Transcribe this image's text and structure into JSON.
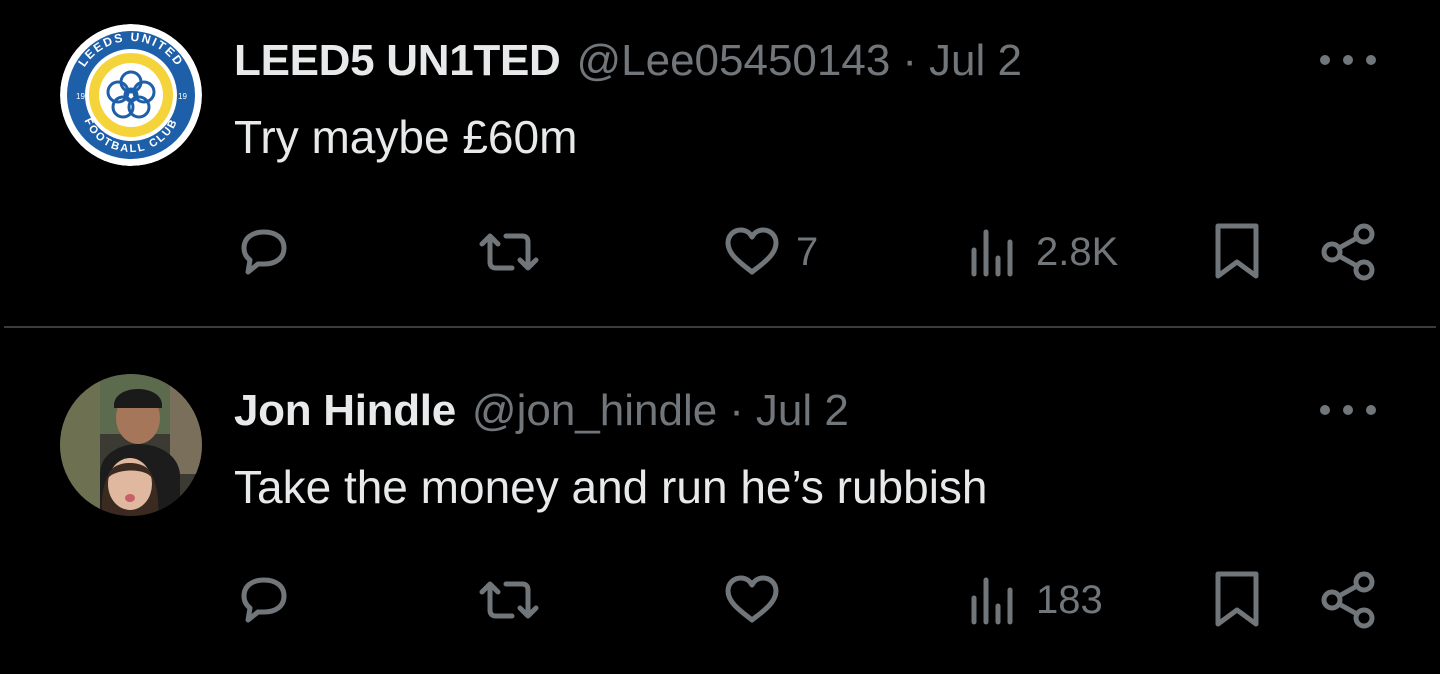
{
  "tweets": [
    {
      "name": "LEED5 UN1TED",
      "handle": "@Lee05450143",
      "separator": "·",
      "date": "Jul 2",
      "text": "Try maybe £60m",
      "avatar": {
        "type": "club-crest",
        "ring_text_top": "LEEDS UNITED",
        "ring_text_bottom": "FOOTBALL CLUB",
        "year_left": "19",
        "year_right": "19"
      },
      "stats": {
        "replies": "",
        "retweets": "",
        "likes": "7",
        "views": "2.8K"
      }
    },
    {
      "name": "Jon Hindle",
      "handle": "@jon_hindle",
      "separator": "·",
      "date": "Jul 2",
      "text": "Take the money and run he’s rubbish",
      "avatar": {
        "type": "photo"
      },
      "stats": {
        "replies": "",
        "retweets": "",
        "likes": "",
        "views": "183"
      }
    }
  ],
  "icons": [
    "reply-icon",
    "retweet-icon",
    "like-icon",
    "views-icon",
    "bookmark-icon",
    "share-icon",
    "more-icon"
  ],
  "colors": {
    "background": "#000000",
    "text": "#e7e9ea",
    "muted": "#71767b",
    "divider": "#3a3d40",
    "crest_blue": "#1d5fa8",
    "crest_yellow": "#f5d33b"
  }
}
